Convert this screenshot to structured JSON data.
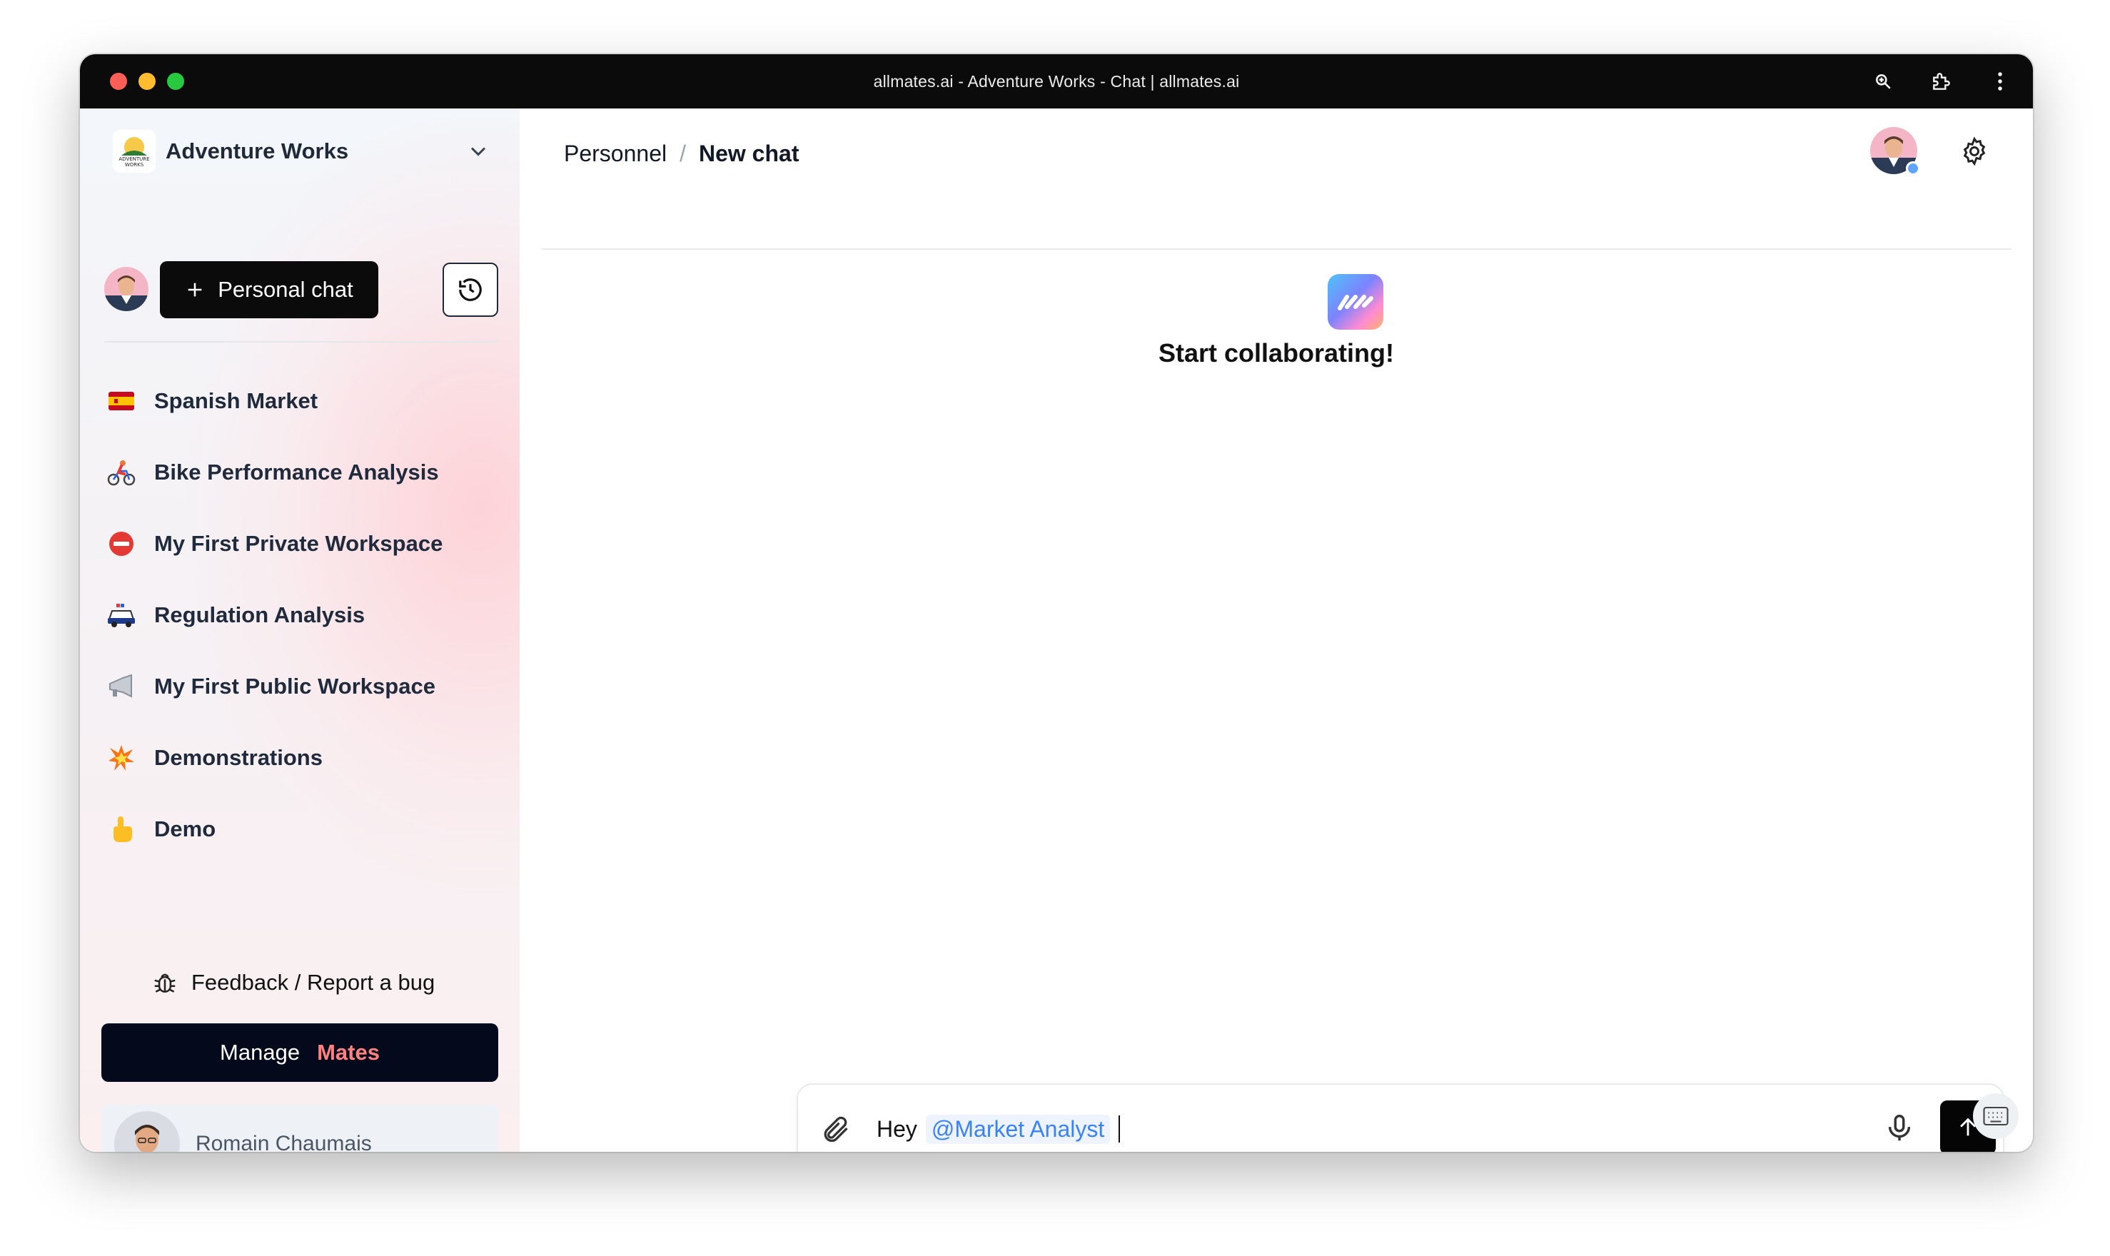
{
  "window": {
    "title": "allmates.ai - Adventure Works - Chat | allmates.ai"
  },
  "sidebar": {
    "org_name": "Adventure Works",
    "personal_chat_label": "Personal chat",
    "workspaces": [
      {
        "emoji": "spain-flag-icon",
        "label": "Spanish Market"
      },
      {
        "emoji": "cyclist-icon",
        "label": "Bike Performance Analysis"
      },
      {
        "emoji": "no-entry-icon",
        "label": "My First Private Workspace"
      },
      {
        "emoji": "police-car-icon",
        "label": "Regulation Analysis"
      },
      {
        "emoji": "megaphone-icon",
        "label": "My First Public Workspace"
      },
      {
        "emoji": "collision-icon",
        "label": "Demonstrations"
      },
      {
        "emoji": "pointing-hand-icon",
        "label": "Demo"
      }
    ],
    "feedback_label": "Feedback / Report a bug",
    "manage_label": "Manage",
    "manage_accent": "Mates",
    "user_name": "Romain Chaumais"
  },
  "main": {
    "breadcrumb": {
      "parent": "Personnel",
      "separator": "/",
      "current": "New chat"
    },
    "hero_title": "Start collaborating!",
    "composer": {
      "text": "Hey",
      "mention": "@Market Analyst"
    }
  },
  "colors": {
    "accent_pink": "#ff8080",
    "mention_blue": "#3b82f6",
    "dark_button": "#0b0b0c"
  }
}
